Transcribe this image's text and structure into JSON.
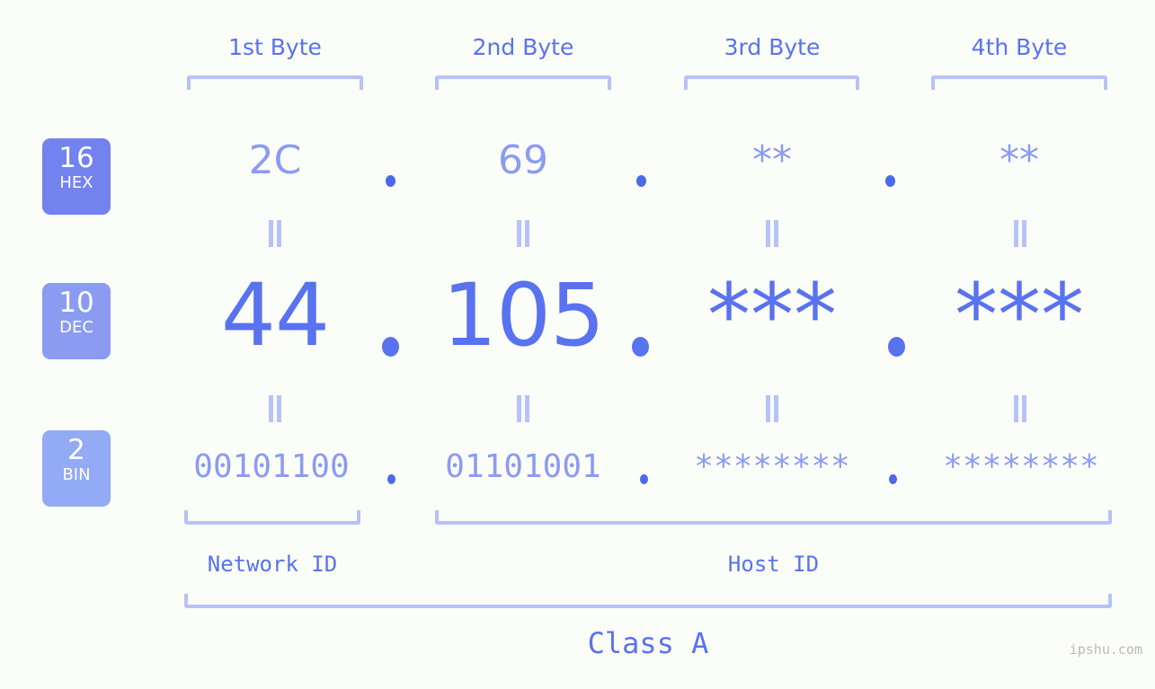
{
  "meta": {
    "watermark": "ipshu.com",
    "background_color": "#fbfdf9",
    "accent_color": "#5872f0",
    "accent_light_color": "#8b9bf2",
    "bracket_color": "#b7c2f7"
  },
  "byte_headers": [
    {
      "label": "1st Byte"
    },
    {
      "label": "2nd Byte"
    },
    {
      "label": "3rd Byte"
    },
    {
      "label": "4th Byte"
    }
  ],
  "rows": [
    {
      "id": "hex",
      "badge": {
        "number": "16",
        "label": "HEX",
        "color": "#7282ee"
      },
      "separator": ".",
      "values": [
        "2C",
        "69",
        "**",
        "**"
      ]
    },
    {
      "id": "dec",
      "badge": {
        "number": "10",
        "label": "DEC",
        "color": "#8b9bf2"
      },
      "separator": ".",
      "values": [
        "44",
        "105",
        "***",
        "***"
      ]
    },
    {
      "id": "bin",
      "badge": {
        "number": "2",
        "label": "BIN",
        "color": "#93aaf5"
      },
      "separator": ".",
      "values": [
        "00101100",
        "01101001",
        "********",
        "********"
      ]
    }
  ],
  "equals_marks": {
    "symbol": "||",
    "count_per_row": 4,
    "rows": 2
  },
  "id_segments": [
    {
      "label": "Network ID",
      "bytes": 1
    },
    {
      "label": "Host ID",
      "bytes": 3
    }
  ],
  "class": {
    "label": "Class A"
  }
}
